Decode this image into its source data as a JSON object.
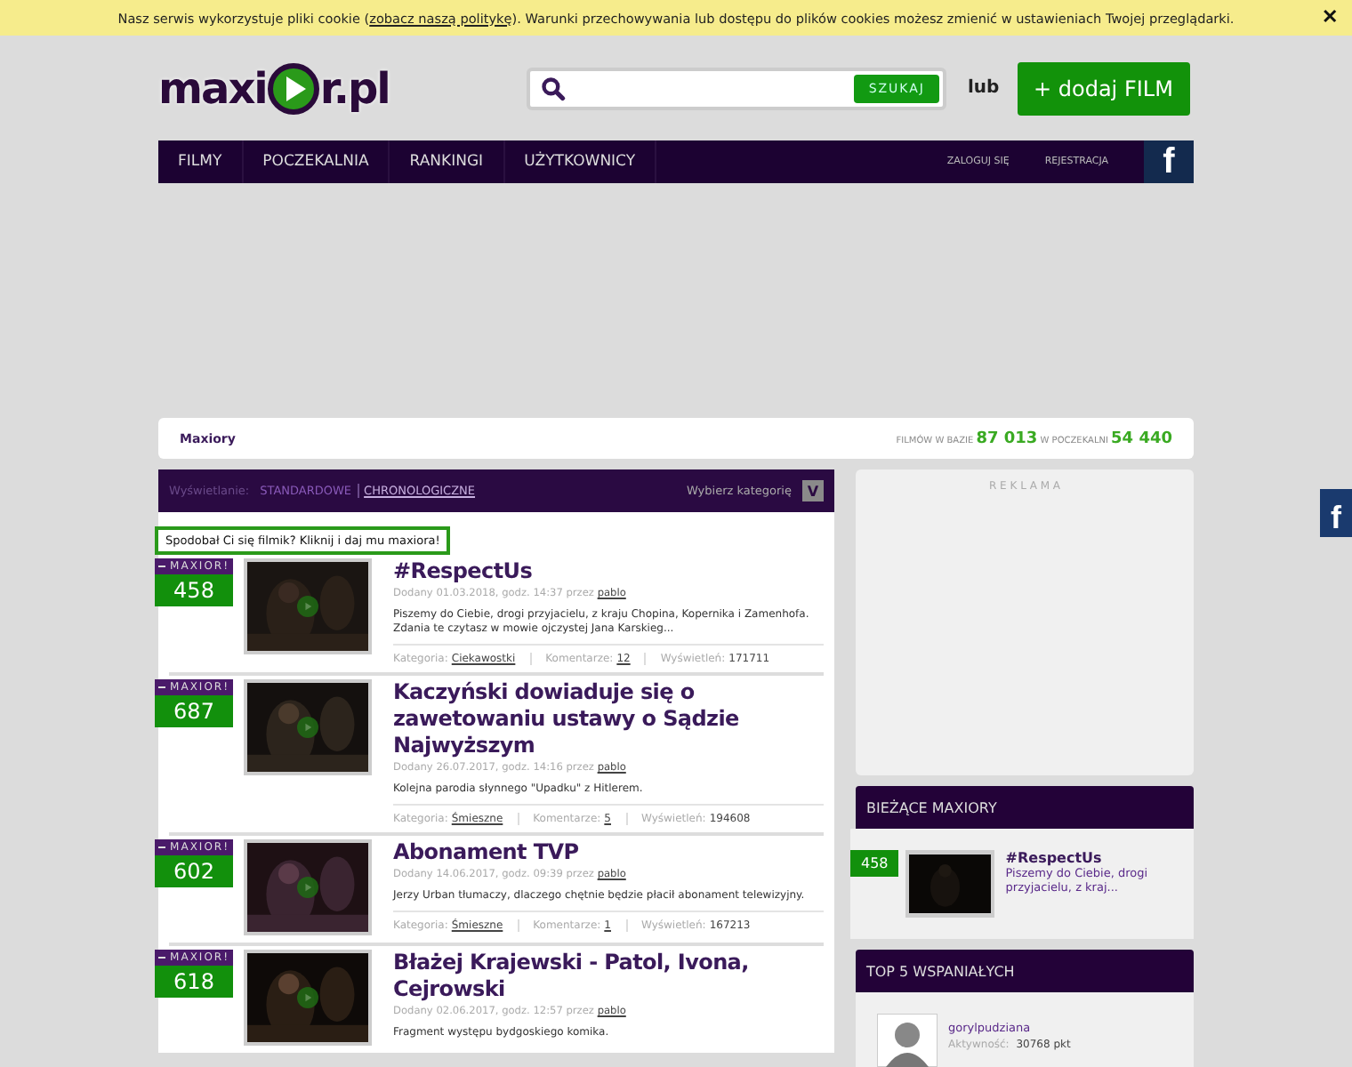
{
  "cookie_bar": {
    "text_before": "Nasz serwis wykorzystuje pliki cookie (",
    "link": "zobacz naszą politykę",
    "text_after": "). Warunki przechowywania lub dostępu do plików cookies możesz zmienić w ustawieniach Twojej przeglądarki.",
    "close": "✕"
  },
  "header": {
    "logo_left": "maxi",
    "logo_right": "r.pl",
    "search_button": "SZUKAJ",
    "or": "lub",
    "add_button": "+ dodaj FILM"
  },
  "nav": {
    "items": [
      "FILMY",
      "POCZEKALNIA",
      "RANKINGI",
      "UŻYTKOWNICY"
    ],
    "login": "ZALOGUJ SIĘ",
    "register": "REJESTRACJA",
    "facebook": "f"
  },
  "breadcrumb": {
    "title": "Maxiory",
    "stats_label_1": "FILMÓW W BAZIE",
    "stats_value_1": "87 013",
    "stats_label_2": "W POCZEKALNI",
    "stats_value_2": "54 440"
  },
  "filter_bar": {
    "label": "Wyświetlanie:",
    "modes": [
      {
        "label": "STANDARDOWE",
        "selected": false
      },
      {
        "label": "CHRONOLOGICZNE",
        "selected": true
      }
    ],
    "category_label": "Wybierz kategorię",
    "category_button": "V"
  },
  "tooltip": "Spodobał Ci się filmik? Kliknij i daj mu maxiora!",
  "videos": [
    {
      "badge": "MAXIOR!",
      "score": "458",
      "title": "#RespectUs",
      "added": "Dodany 01.03.2018, godz. 14:37 przez",
      "author": "pablo",
      "description": "Piszemy do Ciebie, drogi przyjacielu, z kraju Chopina, Kopernika i Zamenhofa. Zdania te czytasz w mowie ojczystej Jana Karskieg...",
      "category_label": "Kategoria:",
      "category": "Ciekawostki",
      "comments_label": "Komentarze:",
      "comments": "12",
      "views_label": "Wyświetleń:",
      "views": "171711"
    },
    {
      "badge": "MAXIOR!",
      "score": "687",
      "title": "Kaczyński dowiaduje się o zawetowaniu ustawy o Sądzie Najwyższym",
      "added": "Dodany 26.07.2017, godz. 14:16 przez",
      "author": "pablo",
      "description": "Kolejna parodia słynnego \"Upadku\" z Hitlerem.",
      "category_label": "Kategoria:",
      "category": "Śmieszne",
      "comments_label": "Komentarze:",
      "comments": "5",
      "views_label": "Wyświetleń:",
      "views": "194608"
    },
    {
      "badge": "MAXIOR!",
      "score": "602",
      "title": "Abonament TVP",
      "added": "Dodany 14.06.2017, godz. 09:39 przez",
      "author": "pablo",
      "description": "Jerzy Urban tłumaczy, dlaczego chętnie będzie płacił abonament telewizyjny.",
      "category_label": "Kategoria:",
      "category": "Śmieszne",
      "comments_label": "Komentarze:",
      "comments": "1",
      "views_label": "Wyświetleń:",
      "views": "167213"
    },
    {
      "badge": "MAXIOR!",
      "score": "618",
      "title": "Błażej Krajewski - Patol, Ivona, Cejrowski",
      "added": "Dodany 02.06.2017, godz. 12:57 przez",
      "author": "pablo",
      "description": "Fragment występu bydgoskiego komika."
    }
  ],
  "sidebar": {
    "ad_label": "R E K L A M A",
    "current_title": "BIEŻĄCE MAXIORY",
    "current": {
      "score": "458",
      "title": "#RespectUs",
      "excerpt": "Piszemy do Ciebie, drogi przyjacielu, z kraj..."
    },
    "top_title": "TOP 5 WSPANIAŁYCH",
    "top_user": {
      "name": "gorylpudziana",
      "activity_label": "Aktywność:",
      "activity": "30768 pkt"
    }
  },
  "side_facebook": "f"
}
